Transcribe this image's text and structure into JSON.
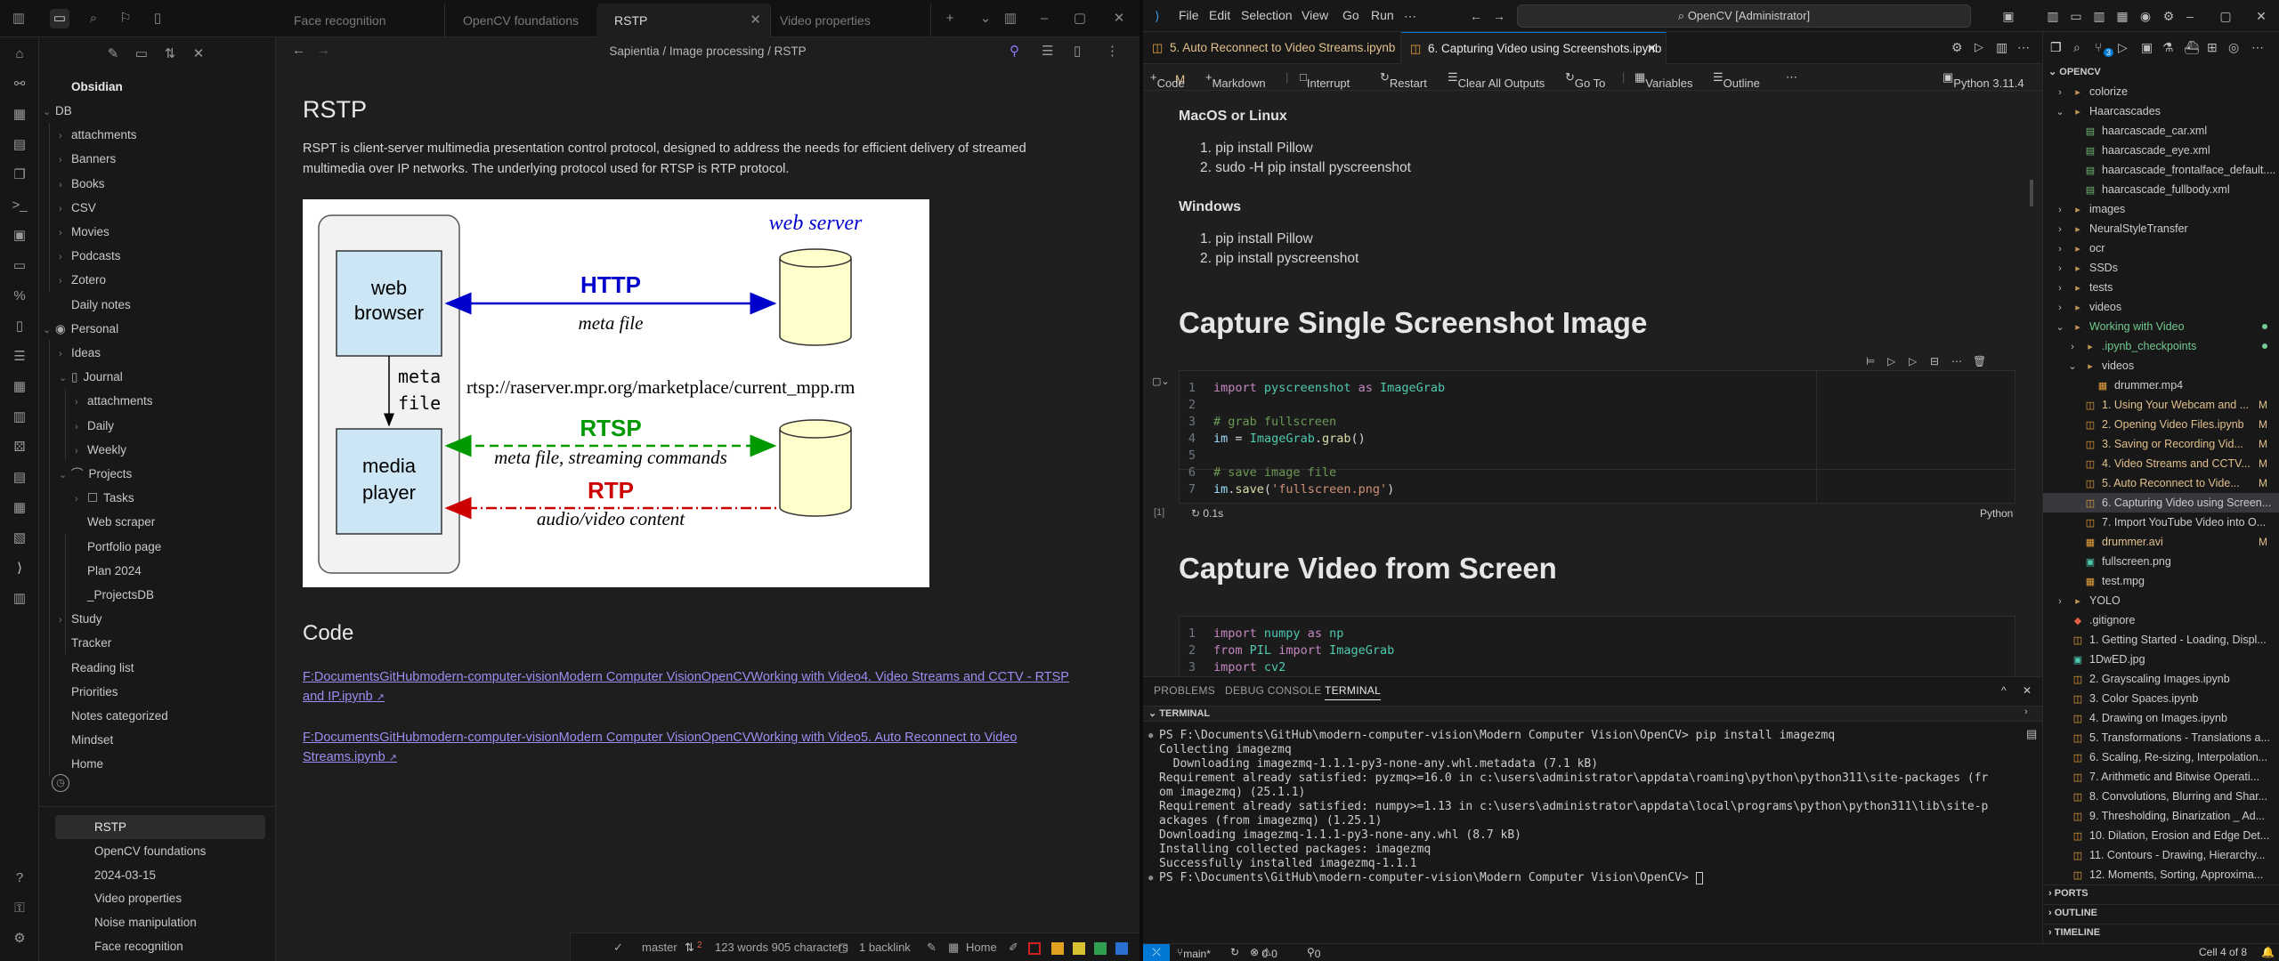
{
  "obsidian": {
    "tabs": [
      "Face recognition",
      "OpenCV foundations",
      "RSTP",
      "Video properties"
    ],
    "breadcrumb": "Sapientia / Image processing / RSTP",
    "vault_name": "Obsidian",
    "tree": [
      {
        "label": "DB",
        "depth": 0,
        "open": true
      },
      {
        "label": "attachments",
        "depth": 1
      },
      {
        "label": "Banners",
        "depth": 1
      },
      {
        "label": "Books",
        "depth": 1
      },
      {
        "label": "CSV",
        "depth": 1
      },
      {
        "label": "Movies",
        "depth": 1
      },
      {
        "label": "Podcasts",
        "depth": 1
      },
      {
        "label": "Zotero",
        "depth": 1
      },
      {
        "label": "Daily notes",
        "depth": 1,
        "file": true
      },
      {
        "label": "Personal",
        "depth": 0,
        "open": true
      },
      {
        "label": "Ideas",
        "depth": 1
      },
      {
        "label": "Journal",
        "depth": 1,
        "open": true
      },
      {
        "label": "attachments",
        "depth": 2
      },
      {
        "label": "Daily",
        "depth": 2
      },
      {
        "label": "Weekly",
        "depth": 2
      },
      {
        "label": "Projects",
        "depth": 1,
        "open": true
      },
      {
        "label": "Tasks",
        "depth": 2
      },
      {
        "label": "Web scraper",
        "depth": 2,
        "file": true
      },
      {
        "label": "Portfolio page",
        "depth": 2,
        "file": true
      },
      {
        "label": "Plan 2024",
        "depth": 2,
        "file": true
      },
      {
        "label": "_ProjectsDB",
        "depth": 2,
        "file": true
      },
      {
        "label": "Study",
        "depth": 1
      },
      {
        "label": "Tracker",
        "depth": 1,
        "file": true
      },
      {
        "label": "Reading list",
        "depth": 1,
        "file": true
      },
      {
        "label": "Priorities",
        "depth": 1,
        "file": true
      },
      {
        "label": "Notes categorized",
        "depth": 1,
        "file": true
      },
      {
        "label": "Mindset",
        "depth": 1,
        "file": true
      },
      {
        "label": "Home",
        "depth": 1,
        "file": true
      }
    ],
    "recent": [
      "RSTP",
      "OpenCV foundations",
      "2024-03-15",
      "Video properties",
      "Noise manipulation",
      "Face recognition"
    ],
    "note": {
      "title": "RSTP",
      "paragraph": "RSPT is client-server multimedia presentation control protocol, designed to address the needs for efficient delivery of streamed multimedia over IP networks. The underlying protocol used for RTSP is RTP protocol.",
      "code_heading": "Code",
      "links": [
        "F:DocumentsGitHubmodern-computer-visionModern Computer VisionOpenCVWorking with Video4. Video Streams and CCTV - RTSP and IP.ipynb",
        "F:DocumentsGitHubmodern-computer-visionModern Computer VisionOpenCVWorking with Video5. Auto Reconnect to Video Streams.ipynb"
      ]
    },
    "diagram": {
      "web_server": "web server",
      "web": "web",
      "browser": "browser",
      "media": "media",
      "player": "player",
      "http": "HTTP",
      "meta_file": "meta file",
      "meta": "meta",
      "file": "file",
      "url": "rtsp://raserver.mpr.org/marketplace/current_mpp.rm",
      "rtsp": "RTSP",
      "rtsp_sub": "meta file, streaming commands",
      "rtp": "RTP",
      "rtp_sub": "audio/video content",
      "colors": {
        "http": "#0000cc",
        "rtsp": "#009900",
        "rtp": "#cc0000",
        "box": "#cce6f5",
        "db": "#ffffcc"
      }
    },
    "status": {
      "branch": "master",
      "sync": "2",
      "words": "123 words 905 characters",
      "backlinks": "1 backlink",
      "home": "Home",
      "swatches": [
        "#cc2222",
        "#e0a020",
        "#d8c030",
        "#30a050",
        "#2a70d0"
      ]
    }
  },
  "vscode": {
    "menu": [
      "File",
      "Edit",
      "Selection",
      "View",
      "Go",
      "Run"
    ],
    "search": "OpenCV [Administrator]",
    "tabs": [
      {
        "label": "5. Auto Reconnect to Video Streams.ipynb",
        "badge": "M"
      },
      {
        "label": "6. Capturing Video using Screenshots.ipynb",
        "close": "✕"
      }
    ],
    "toolbar": {
      "code": "Code",
      "markdown": "Markdown",
      "interrupt": "Interrupt",
      "restart": "Restart",
      "clear": "Clear All Outputs",
      "goto": "Go To",
      "variables": "Variables",
      "outline": "Outline",
      "kernel": "Python 3.11.4"
    },
    "md": {
      "h_mac": "MacOS or Linux",
      "mac_items": [
        "pip install Pillow",
        "sudo -H pip install pyscreenshot"
      ],
      "h_win": "Windows",
      "win_items": [
        "pip install Pillow",
        "pip install pyscreenshot"
      ],
      "h1_single": "Capture Single Screenshot Image",
      "h1_video": "Capture Video from Screen"
    },
    "cell1": {
      "exec": "[1]",
      "time": "0.1s",
      "lang": "Python"
    },
    "panel_tabs": [
      "PROBLEMS",
      "DEBUG CONSOLE",
      "TERMINAL"
    ],
    "terminal_label": "TERMINAL",
    "terminal": [
      "PS F:\\Documents\\GitHub\\modern-computer-vision\\Modern Computer Vision\\OpenCV> pip install imagezmq",
      "Collecting imagezmq",
      "  Downloading imagezmq-1.1.1-py3-none-any.whl.metadata (7.1 kB)",
      "Requirement already satisfied: pyzmq>=16.0 in c:\\users\\administrator\\appdata\\roaming\\python\\python311\\site-packages (fr",
      "om imagezmq) (25.1.1)",
      "Requirement already satisfied: numpy>=1.13 in c:\\users\\administrator\\appdata\\local\\programs\\python\\python311\\lib\\site-p",
      "ackages (from imagezmq) (1.25.1)",
      "Downloading imagezmq-1.1.1-py3-none-any.whl (8.7 kB)",
      "Installing collected packages: imagezmq",
      "Successfully installed imagezmq-1.1.1",
      "PS F:\\Documents\\GitHub\\modern-computer-vision\\Modern Computer Vision\\OpenCV> "
    ],
    "explorer_title": "OPENCV",
    "explorer": [
      {
        "label": "colorize",
        "type": "folder",
        "depth": 0
      },
      {
        "label": "Haarcascades",
        "type": "folder",
        "depth": 0,
        "open": true
      },
      {
        "label": "haarcascade_car.xml",
        "type": "xml",
        "depth": 1
      },
      {
        "label": "haarcascade_eye.xml",
        "type": "xml",
        "depth": 1
      },
      {
        "label": "haarcascade_frontalface_default....",
        "type": "xml",
        "depth": 1
      },
      {
        "label": "haarcascade_fullbody.xml",
        "type": "xml",
        "depth": 1
      },
      {
        "label": "images",
        "type": "folder",
        "depth": 0
      },
      {
        "label": "NeuralStyleTransfer",
        "type": "folder",
        "depth": 0
      },
      {
        "label": "ocr",
        "type": "folder",
        "depth": 0
      },
      {
        "label": "SSDs",
        "type": "folder",
        "depth": 0
      },
      {
        "label": "tests",
        "type": "folder",
        "depth": 0
      },
      {
        "label": "videos",
        "type": "folder",
        "depth": 0
      },
      {
        "label": "Working with Video",
        "type": "folder",
        "depth": 0,
        "open": true,
        "color": "#73c991",
        "dot": true
      },
      {
        "label": ".ipynb_checkpoints",
        "type": "folder",
        "depth": 1,
        "color": "#73c991",
        "dot": true
      },
      {
        "label": "videos",
        "type": "folder",
        "depth": 1,
        "open": true
      },
      {
        "label": "drummer.mp4",
        "type": "media",
        "depth": 2
      },
      {
        "label": "1. Using Your Webcam and ...",
        "type": "nb",
        "depth": 1,
        "color": "#e2c08d",
        "status": "M"
      },
      {
        "label": "2. Opening Video Files.ipynb",
        "type": "nb",
        "depth": 1,
        "color": "#e2c08d",
        "status": "M"
      },
      {
        "label": "3. Saving or Recording Vid...",
        "type": "nb",
        "depth": 1,
        "color": "#e2c08d",
        "status": "M"
      },
      {
        "label": "4. Video Streams and CCTV...",
        "type": "nb",
        "depth": 1,
        "color": "#e2c08d",
        "status": "M"
      },
      {
        "label": "5. Auto Reconnect to Vide...",
        "type": "nb",
        "depth": 1,
        "color": "#e2c08d",
        "status": "M"
      },
      {
        "label": "6. Capturing Video using Screen...",
        "type": "nb",
        "depth": 1,
        "selected": true
      },
      {
        "label": "7. Import YouTube Video into O...",
        "type": "nb",
        "depth": 1
      },
      {
        "label": "drummer.avi",
        "type": "media",
        "depth": 1,
        "color": "#e2c08d",
        "status": "M"
      },
      {
        "label": "fullscreen.png",
        "type": "img",
        "depth": 1
      },
      {
        "label": "test.mpg",
        "type": "media",
        "depth": 1
      },
      {
        "label": "YOLO",
        "type": "folder",
        "depth": 0
      },
      {
        "label": ".gitignore",
        "type": "git",
        "depth": 0
      },
      {
        "label": "1. Getting Started - Loading, Displ...",
        "type": "nb",
        "depth": 0
      },
      {
        "label": "1DwED.jpg",
        "type": "img",
        "depth": 0
      },
      {
        "label": "2. Grayscaling Images.ipynb",
        "type": "nb",
        "depth": 0
      },
      {
        "label": "3. Color Spaces.ipynb",
        "type": "nb",
        "depth": 0
      },
      {
        "label": "4. Drawing on Images.ipynb",
        "type": "nb",
        "depth": 0
      },
      {
        "label": "5. Transformations - Translations a...",
        "type": "nb",
        "depth": 0
      },
      {
        "label": "6. Scaling, Re-sizing, Interpolation...",
        "type": "nb",
        "depth": 0
      },
      {
        "label": "7. Arithmetic and Bitwise Operati...",
        "type": "nb",
        "depth": 0
      },
      {
        "label": "8. Convolutions, Blurring and Shar...",
        "type": "nb",
        "depth": 0
      },
      {
        "label": "9. Thresholding, Binarization _ Ad...",
        "type": "nb",
        "depth": 0
      },
      {
        "label": "10. Dilation, Erosion and Edge Det...",
        "type": "nb",
        "depth": 0
      },
      {
        "label": "11. Contours - Drawing, Hierarchy...",
        "type": "nb",
        "depth": 0
      },
      {
        "label": "12. Moments, Sorting, Approxima...",
        "type": "nb",
        "depth": 0
      }
    ],
    "sections": [
      "PORTS",
      "OUTLINE",
      "TIMELINE"
    ],
    "status": {
      "branch": "main*",
      "errors": "0",
      "warnings": "0",
      "ports": "0",
      "cell": "Cell 4 of 8"
    }
  }
}
